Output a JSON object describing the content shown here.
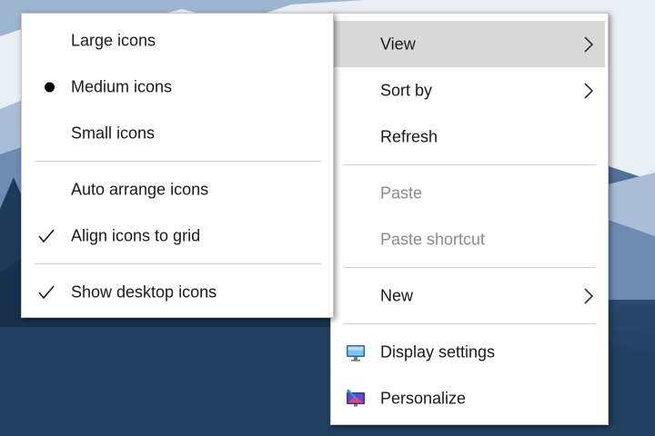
{
  "context_menu": {
    "items": [
      {
        "label": "View",
        "enabled": true,
        "submenu": true,
        "highlighted": true
      },
      {
        "label": "Sort by",
        "enabled": true,
        "submenu": true
      },
      {
        "label": "Refresh",
        "enabled": true
      },
      {
        "label": "Paste",
        "enabled": false
      },
      {
        "label": "Paste shortcut",
        "enabled": false
      },
      {
        "label": "New",
        "enabled": true,
        "submenu": true
      },
      {
        "label": "Display settings",
        "enabled": true,
        "icon": "display-settings-icon"
      },
      {
        "label": "Personalize",
        "enabled": true,
        "icon": "personalize-icon"
      }
    ]
  },
  "view_submenu": {
    "items": [
      {
        "label": "Large icons",
        "selected": false
      },
      {
        "label": "Medium icons",
        "selected": true,
        "mark": "bullet"
      },
      {
        "label": "Small icons",
        "selected": false
      },
      {
        "label": "Auto arrange icons",
        "checked": false
      },
      {
        "label": "Align icons to grid",
        "checked": true,
        "mark": "check"
      },
      {
        "label": "Show desktop icons",
        "checked": true,
        "mark": "check"
      }
    ]
  },
  "colors": {
    "menu_background": "#ffffff",
    "highlight": "#d9d9d9",
    "text": "#1a1a1a",
    "disabled_text": "#8a8a8a",
    "separator": "#d0d0d0"
  }
}
